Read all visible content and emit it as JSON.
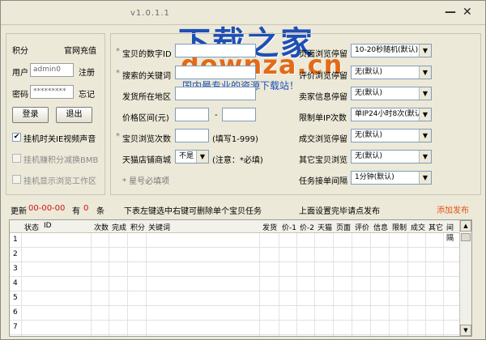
{
  "window": {
    "version": "v1.0.1.1",
    "minimize": "—",
    "close": "✕"
  },
  "watermark": {
    "title": "下载之家",
    "domain": "downza.cn",
    "slogan": "国内最专业的资源下载站！"
  },
  "account": {
    "points_label": "积分",
    "recharge_link": "官网充值",
    "user_label": "用户",
    "user_value": "admin0",
    "register_link": "注册",
    "password_label": "密码",
    "password_value": "*********",
    "forgot_link": "忘记",
    "login_button": "登录",
    "logout_button": "退出",
    "options": [
      {
        "label": "挂机时关IE视频声音",
        "checked": true,
        "disabled": false
      },
      {
        "label": "挂机赚积分减换BMB",
        "checked": false,
        "disabled": true
      },
      {
        "label": "挂机显示浏览工作区",
        "checked": false,
        "disabled": true
      }
    ]
  },
  "task_form": {
    "product_id_label": "宝贝的数字ID",
    "keyword_label": "搜索的关键词",
    "location_label": "发货所在地区",
    "price_range_label": "价格区间(元)",
    "price_dash": "-",
    "browse_count_label": "宝贝浏览次数",
    "browse_count_hint": "(填写1-999)",
    "tmall_label": "天猫店铺商城",
    "tmall_value": "不是",
    "tmall_hint": "(注意：*必填)",
    "required_note": "* 星号必填项",
    "star": "*"
  },
  "settings": [
    {
      "label": "页面浏览停留",
      "value": "10-20秒随机(默认)"
    },
    {
      "label": "评价浏览停留",
      "value": "无(默认)"
    },
    {
      "label": "卖家信息停留",
      "value": "无(默认)"
    },
    {
      "label": "限制单IP次数",
      "value": "单IP24小时8次(默认)"
    },
    {
      "label": "成交浏览停留",
      "value": "无(默认)"
    },
    {
      "label": "其它宝贝浏览",
      "value": "无(默认)"
    },
    {
      "label": "任务接单间隔",
      "value": "1分钟(默认)"
    }
  ],
  "status_bar": {
    "update_label": "更新",
    "update_time": "00-00-00",
    "has_label": "有",
    "count": "0",
    "count_unit": "条",
    "hint": "下表左键选中右键可删除单个宝贝任务",
    "publish_hint": "上面设置完毕请点发布",
    "add_publish": "添加发布"
  },
  "table": {
    "columns": [
      "状态",
      "ID",
      "次数",
      "完成",
      "积分",
      "关键词",
      "发货",
      "价-1",
      "价-2",
      "天猫",
      "页面",
      "评价",
      "信息",
      "限制",
      "成交",
      "其它",
      "间隔"
    ],
    "rows": [
      "1",
      "2",
      "3",
      "4",
      "5",
      "6",
      "7"
    ]
  }
}
